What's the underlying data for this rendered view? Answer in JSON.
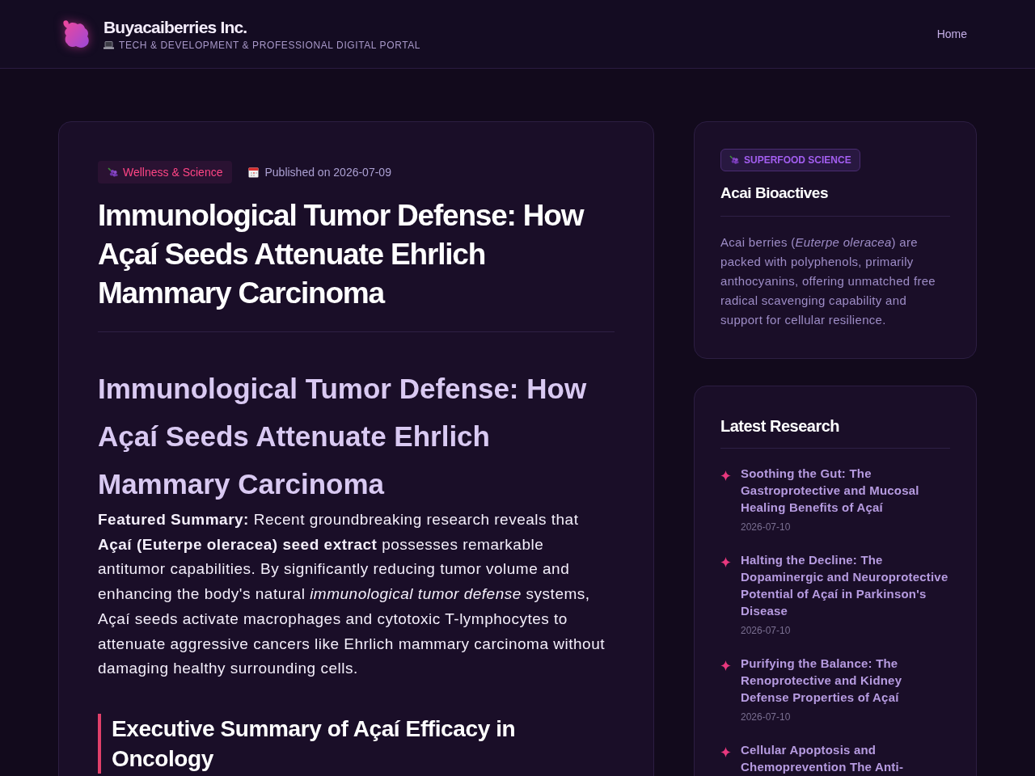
{
  "header": {
    "brand": {
      "name": "Buyacaiberries Inc.",
      "tagline": "TECH & DEVELOPMENT & PROFESSIONAL DIGITAL PORTAL"
    },
    "nav": [
      {
        "label": "Home"
      }
    ]
  },
  "article": {
    "category": "Wellness & Science",
    "published": "Published on 2026-07-09",
    "title": "Immunological Tumor Defense: How Açaí Seeds Attenuate Ehrlich Mammary Carcinoma",
    "body": [
      {
        "kind": "subtitle",
        "text": "Immunological Tumor Defense: How Açaí Seeds Attenuate Ehrlich Mammary Carcinoma"
      },
      {
        "kind": "paragraph",
        "text": "**Featured Summary:** Recent groundbreaking research reveals that **Açaí (Euterpe oleracea) seed extract** possesses remarkable antitumor capabilities. By significantly reducing tumor volume and enhancing the body's natural *immunological tumor defense* systems, Açaí seeds activate macrophages and cytotoxic T-lymphocytes to attenuate aggressive cancers like Ehrlich mammary carcinoma without damaging healthy surrounding cells."
      },
      {
        "kind": "section_heading",
        "text": "Executive Summary of Açaí Efficacy in Oncology"
      }
    ]
  },
  "sidebar": {
    "about": {
      "badge": "SUPERFOOD SCIENCE",
      "title": "Acai Bioactives",
      "text": "Acai berries (*Euterpe oleracea*) are packed with polyphenols, primarily anthocyanins, offering unmatched free radical scavenging capability and support for cellular resilience."
    },
    "latest": {
      "title": "Latest Research",
      "items": [
        {
          "title": "Soothing the Gut: The Gastroprotective and Mucosal Healing Benefits of Açaí",
          "date": "2026-07-10"
        },
        {
          "title": "Halting the Decline: The Dopaminergic and Neuroprotective Potential of Açaí in Parkinson's Disease",
          "date": "2026-07-10"
        },
        {
          "title": "Purifying the Balance: The Renoprotective and Kidney Defense Properties of Açaí",
          "date": "2026-07-10"
        },
        {
          "title": "Cellular Apoptosis and Chemoprevention The Anti-"
        }
      ]
    }
  }
}
